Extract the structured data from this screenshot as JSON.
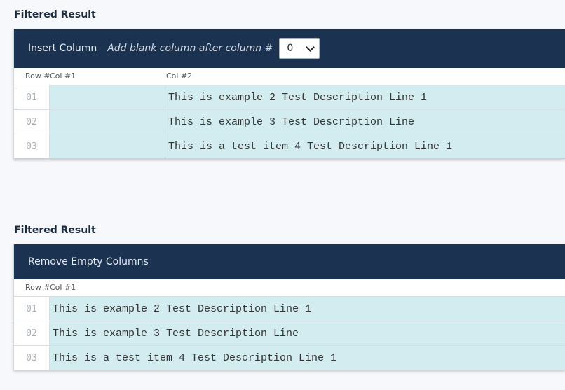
{
  "section1": {
    "title": "Filtered Result",
    "header_title": "Insert Column",
    "hint": "Add blank column after column #",
    "select_value": "0",
    "col_headers": [
      "Row #",
      "Col #1",
      "Col #2"
    ],
    "rows": [
      {
        "num": "01",
        "col1": "",
        "col2": "This is example 2 Test Description Line 1"
      },
      {
        "num": "02",
        "col1": "",
        "col2": "This is example 3 Test Description Line"
      },
      {
        "num": "03",
        "col1": "",
        "col2": "This is a test item 4 Test Description Line 1"
      }
    ]
  },
  "section2": {
    "title": "Filtered Result",
    "header_title": "Remove Empty Columns",
    "col_headers": [
      "Row #",
      "Col #1"
    ],
    "rows": [
      {
        "num": "01",
        "col1": "This is example 2 Test Description Line 1"
      },
      {
        "num": "02",
        "col1": "This is example 3 Test Description Line"
      },
      {
        "num": "03",
        "col1": "This is a test item 4 Test Description Line 1"
      }
    ]
  },
  "icons": {
    "select_arrow": "chevron-down-icon"
  }
}
